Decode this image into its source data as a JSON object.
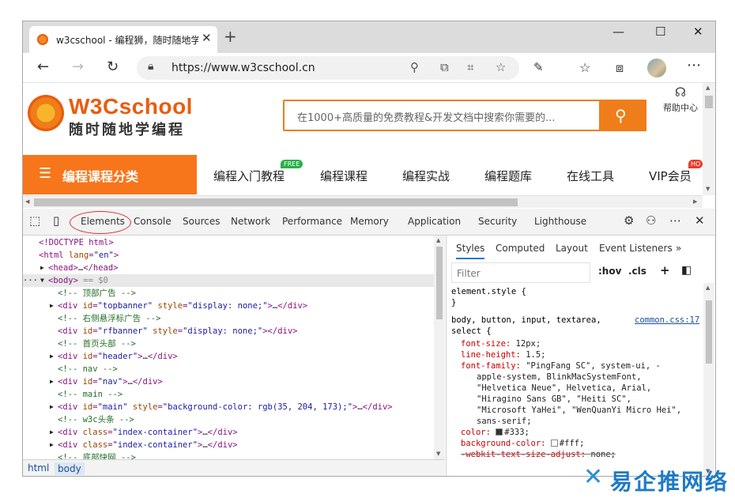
{
  "browser": {
    "tab_title": "w3cschool - 编程狮，随时随地学",
    "url": "https://www.w3cschool.cn",
    "new_tab": "+",
    "close_tab": "✕",
    "win_min": "—",
    "win_max": "☐",
    "win_close": "✕"
  },
  "site": {
    "logo_name": "W3Cschool",
    "logo_slogan": "随时随地学编程",
    "search_placeholder": "在1000+高质量的免费教程&开发文档中搜索你需要的...",
    "help_label": "帮助中心",
    "category_button": "编程课程分类",
    "menu": [
      "编程入门教程",
      "编程课程",
      "编程实战",
      "编程题库",
      "在线工具",
      "VIP会员"
    ],
    "badge_free": "FREE",
    "badge_hot": "HO"
  },
  "devtools": {
    "tabs": [
      "Elements",
      "Console",
      "Sources",
      "Network",
      "Performance",
      "Memory",
      "Application",
      "Security",
      "Lighthouse"
    ],
    "active_tab": "Elements",
    "dom_lines": [
      {
        "indent": 0,
        "arrow": "",
        "parts": [
          [
            "t-tag",
            "<!DOCTYPE html>"
          ]
        ]
      },
      {
        "indent": 0,
        "arrow": "",
        "parts": [
          [
            "t-tag",
            "<html "
          ],
          [
            "t-attr",
            "lang"
          ],
          [
            "t-tag",
            "="
          ],
          [
            "t-val",
            "\"en\""
          ],
          [
            "t-tag",
            ">"
          ]
        ]
      },
      {
        "indent": 1,
        "arrow": "▶",
        "parts": [
          [
            "t-tag",
            "<head>"
          ],
          [
            "t-plain",
            "…"
          ],
          [
            "t-tag",
            "</head>"
          ]
        ]
      },
      {
        "indent": 1,
        "arrow": "▼",
        "selected": true,
        "parts": [
          [
            "t-tag",
            "<body>"
          ],
          [
            "t-dim",
            " == $0"
          ]
        ]
      },
      {
        "indent": 2,
        "arrow": "",
        "parts": [
          [
            "t-cmt",
            "<!-- 顶部广告 -->"
          ]
        ]
      },
      {
        "indent": 2,
        "arrow": "▶",
        "parts": [
          [
            "t-tag",
            "<div "
          ],
          [
            "t-attr",
            "id"
          ],
          [
            "t-tag",
            "="
          ],
          [
            "t-val",
            "\"topbanner\""
          ],
          [
            "t-attr",
            " style"
          ],
          [
            "t-tag",
            "="
          ],
          [
            "t-val",
            "\"display: none;\""
          ],
          [
            "t-tag",
            ">"
          ],
          [
            "t-plain",
            "…"
          ],
          [
            "t-tag",
            "</div>"
          ]
        ]
      },
      {
        "indent": 2,
        "arrow": "",
        "parts": [
          [
            "t-cmt",
            "<!-- 右侧悬浮标广告 -->"
          ]
        ]
      },
      {
        "indent": 2,
        "arrow": "",
        "parts": [
          [
            "t-tag",
            "<div "
          ],
          [
            "t-attr",
            "id"
          ],
          [
            "t-tag",
            "="
          ],
          [
            "t-val",
            "\"rfbanner\""
          ],
          [
            "t-attr",
            " style"
          ],
          [
            "t-tag",
            "="
          ],
          [
            "t-val",
            "\"display: none;\""
          ],
          [
            "t-tag",
            "></div>"
          ]
        ]
      },
      {
        "indent": 2,
        "arrow": "",
        "parts": [
          [
            "t-cmt",
            "<!-- 首页头部 -->"
          ]
        ]
      },
      {
        "indent": 2,
        "arrow": "▶",
        "parts": [
          [
            "t-tag",
            "<div "
          ],
          [
            "t-attr",
            "id"
          ],
          [
            "t-tag",
            "="
          ],
          [
            "t-val",
            "\"header\""
          ],
          [
            "t-tag",
            ">"
          ],
          [
            "t-plain",
            "…"
          ],
          [
            "t-tag",
            "</div>"
          ]
        ]
      },
      {
        "indent": 2,
        "arrow": "",
        "parts": [
          [
            "t-cmt",
            "<!-- nav -->"
          ]
        ]
      },
      {
        "indent": 2,
        "arrow": "▶",
        "parts": [
          [
            "t-tag",
            "<div "
          ],
          [
            "t-attr",
            "id"
          ],
          [
            "t-tag",
            "="
          ],
          [
            "t-val",
            "\"nav\""
          ],
          [
            "t-tag",
            ">"
          ],
          [
            "t-plain",
            "…"
          ],
          [
            "t-tag",
            "</div>"
          ]
        ]
      },
      {
        "indent": 2,
        "arrow": "",
        "parts": [
          [
            "t-cmt",
            "<!-- main -->"
          ]
        ]
      },
      {
        "indent": 2,
        "arrow": "▶",
        "parts": [
          [
            "t-tag",
            "<div "
          ],
          [
            "t-attr",
            "id"
          ],
          [
            "t-tag",
            "="
          ],
          [
            "t-val",
            "\"main\""
          ],
          [
            "t-attr",
            " style"
          ],
          [
            "t-tag",
            "="
          ],
          [
            "t-val",
            "\"background-color: rgb(35, 204, 173);\""
          ],
          [
            "t-tag",
            ">"
          ],
          [
            "t-plain",
            "…"
          ],
          [
            "t-tag",
            "</div>"
          ]
        ]
      },
      {
        "indent": 2,
        "arrow": "",
        "parts": [
          [
            "t-cmt",
            "<!-- w3c头条 -->"
          ]
        ]
      },
      {
        "indent": 2,
        "arrow": "▶",
        "parts": [
          [
            "t-tag",
            "<div "
          ],
          [
            "t-attr",
            "class"
          ],
          [
            "t-tag",
            "="
          ],
          [
            "t-val",
            "\"index-container\""
          ],
          [
            "t-tag",
            ">"
          ],
          [
            "t-plain",
            "…"
          ],
          [
            "t-tag",
            "</div>"
          ]
        ]
      },
      {
        "indent": 2,
        "arrow": "▶",
        "parts": [
          [
            "t-tag",
            "<div "
          ],
          [
            "t-attr",
            "class"
          ],
          [
            "t-tag",
            "="
          ],
          [
            "t-val",
            "\"index-container\""
          ],
          [
            "t-tag",
            ">"
          ],
          [
            "t-plain",
            "…"
          ],
          [
            "t-tag",
            "</div>"
          ]
        ]
      },
      {
        "indent": 2,
        "arrow": "",
        "parts": [
          [
            "t-cmt",
            "<!-- 底部快网 -->"
          ]
        ]
      }
    ],
    "dots": "···",
    "breadcrumbs": [
      "html",
      "body"
    ],
    "styles_tabs": [
      "Styles",
      "Computed",
      "Layout",
      "Event Listeners",
      "»"
    ],
    "filter_placeholder": "Filter",
    "hov": ":hov",
    "cls": ".cls",
    "plus": "+",
    "element_style": "element.style {",
    "close_brace": "}",
    "rule_selector_1": "body, button, input, textarea,",
    "rule_selector_2": "select {",
    "rule_source": "common.css:17",
    "props": [
      {
        "name": "font-size",
        "value": "12px;"
      },
      {
        "name": "line-height",
        "value": "1.5;"
      },
      {
        "name": "font-family",
        "value": "\"PingFang SC\", system-ui, -"
      },
      {
        "name": "",
        "value": "apple-system, BlinkMacSystemFont,"
      },
      {
        "name": "",
        "value": "\"Helvetica Neue\", Helvetica, Arial,"
      },
      {
        "name": "",
        "value": "\"Hiragino Sans GB\", \"Heiti SC\","
      },
      {
        "name": "",
        "value": "\"Microsoft YaHei\", \"WenQuanYi Micro Hei\","
      },
      {
        "name": "",
        "value": "sans-serif;"
      },
      {
        "name": "color",
        "value": "#333;"
      },
      {
        "name": "background-color",
        "value": "#fff;"
      },
      {
        "name": "-webkit-text-size-adjust",
        "value": "none;"
      }
    ],
    "colors": {
      "color_swatch": "#333333",
      "bg_swatch": "#ffffff"
    }
  },
  "watermark": {
    "text": "易企推网络"
  }
}
